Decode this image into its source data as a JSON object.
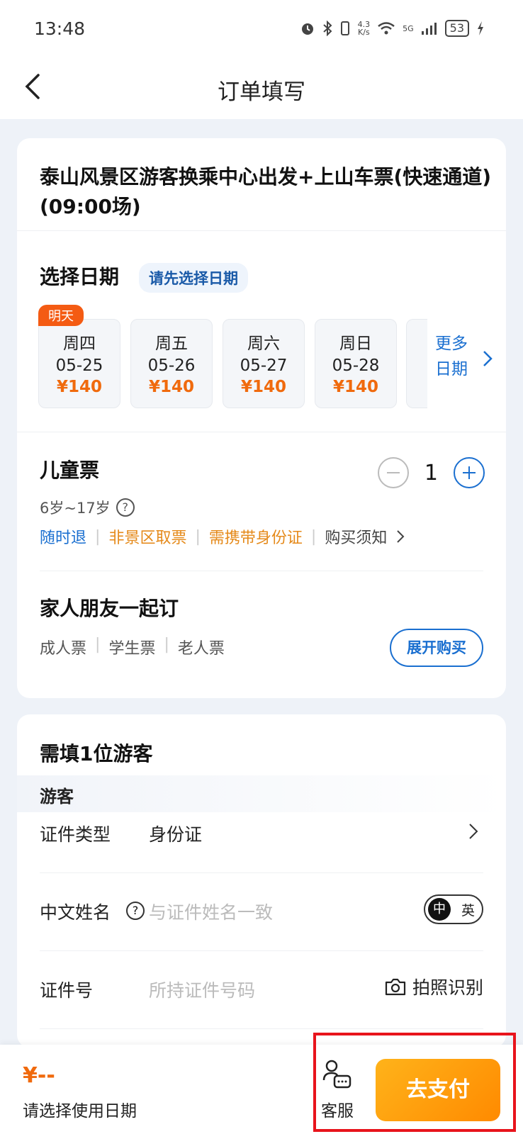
{
  "status_bar": {
    "time": "13:48",
    "speed_value": "4.3",
    "speed_unit": "K/s",
    "network": "5G",
    "battery": "53"
  },
  "nav": {
    "title": "订单填写"
  },
  "product": {
    "title": "泰山风景区游客换乘中心出发+上山车票(快速通道)(09:00场)"
  },
  "date_section": {
    "title": "选择日期",
    "hint": "请先选择日期",
    "tomorrow_badge": "明天",
    "dates": [
      {
        "weekday": "周四",
        "date": "05-25",
        "price": "¥140"
      },
      {
        "weekday": "周五",
        "date": "05-26",
        "price": "¥140"
      },
      {
        "weekday": "周六",
        "date": "05-27",
        "price": "¥140"
      },
      {
        "weekday": "周日",
        "date": "05-28",
        "price": "¥140"
      }
    ],
    "more_line1": "更多",
    "more_line2": "日期"
  },
  "child_ticket": {
    "title": "儿童票",
    "age": "6岁~17岁",
    "quantity": "1",
    "tags": {
      "refund": "随时退",
      "pickup": "非景区取票",
      "id_required": "需携带身份证",
      "notice": "购买须知"
    }
  },
  "family": {
    "title": "家人朋友一起订",
    "types": [
      "成人票",
      "学生票",
      "老人票"
    ],
    "expand_label": "展开购买"
  },
  "visitor_section": {
    "title": "需填1位游客",
    "visitor_label": "游客",
    "id_type_label": "证件类型",
    "id_type_value": "身份证",
    "name_label": "中文姓名",
    "name_placeholder": "与证件姓名一致",
    "lang_zh": "中",
    "lang_en": "英",
    "id_number_label": "证件号",
    "id_number_placeholder": "所持证件号码",
    "photo_label": "拍照识别"
  },
  "bottom_bar": {
    "price": "¥--",
    "hint": "请选择使用日期",
    "service_label": "客服",
    "pay_label": "去支付"
  },
  "colors": {
    "accent_blue": "#1a6fd0",
    "price_orange": "#f06a0d",
    "pay_gradient_start": "#ffb31a",
    "pay_gradient_end": "#ff8a00",
    "highlight_red": "#e8141c"
  }
}
